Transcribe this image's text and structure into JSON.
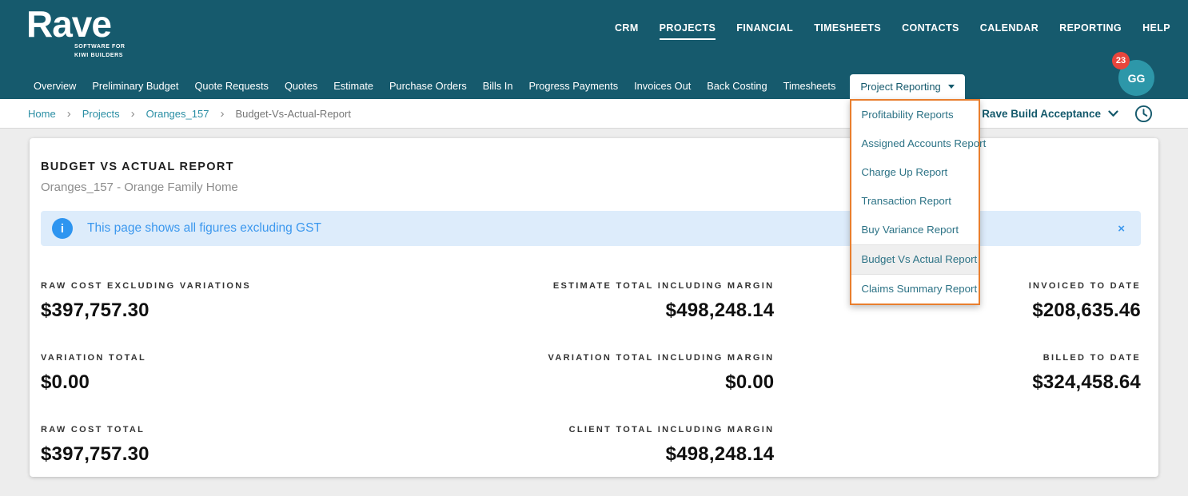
{
  "colors": {
    "header_teal": "#165a6d",
    "accent_orange": "#e87e2e",
    "badge_red": "#e8453c",
    "info_blue": "#3c98ee",
    "info_bg": "#ddecfb",
    "avatar_teal": "#2d97a9",
    "link_teal": "#2a8ea4"
  },
  "header": {
    "logo": {
      "word": "Rave",
      "tagline1": "SOFTWARE FOR",
      "tagline2": "KIWI BUILDERS"
    },
    "nav": [
      "CRM",
      "PROJECTS",
      "FINANCIAL",
      "TIMESHEETS",
      "CONTACTS",
      "CALENDAR",
      "REPORTING",
      "HELP"
    ],
    "active_nav": "PROJECTS",
    "avatar": {
      "initials": "GG",
      "badge_count": "23"
    }
  },
  "subnav": {
    "items": [
      "Overview",
      "Preliminary Budget",
      "Quote Requests",
      "Quotes",
      "Estimate",
      "Purchase Orders",
      "Bills In",
      "Progress Payments",
      "Invoices Out",
      "Back Costing",
      "Timesheets"
    ],
    "dropdown_label": "Project Reporting"
  },
  "dropdown_menu": {
    "items": [
      "Profitability Reports",
      "Assigned Accounts Report",
      "Charge Up Report",
      "Transaction Report",
      "Buy Variance Report",
      "Budget Vs Actual Report",
      "Claims Summary Report"
    ],
    "active_item": "Budget Vs Actual Report"
  },
  "breadcrumb": {
    "separator": "›",
    "links": [
      "Home",
      "Projects",
      "Oranges_157"
    ],
    "current": "Budget-Vs-Actual-Report"
  },
  "toolbar": {
    "project_selector": "Rave Build Acceptance"
  },
  "report": {
    "title": "BUDGET VS ACTUAL REPORT",
    "subtitle": "Oranges_157 - Orange Family Home",
    "banner": {
      "info_glyph": "i",
      "text": "This page shows all figures excluding GST",
      "close_glyph": "×"
    },
    "stats": [
      {
        "label": "RAW COST EXCLUDING VARIATIONS",
        "value": "$397,757.30"
      },
      {
        "label": "ESTIMATE TOTAL INCLUDING MARGIN",
        "value": "$498,248.14"
      },
      {
        "label": "INVOICED TO DATE",
        "value": "$208,635.46"
      },
      {
        "label": "VARIATION TOTAL",
        "value": "$0.00"
      },
      {
        "label": "VARIATION TOTAL INCLUDING MARGIN",
        "value": "$0.00"
      },
      {
        "label": "BILLED TO DATE",
        "value": "$324,458.64"
      },
      {
        "label": "RAW COST TOTAL",
        "value": "$397,757.30"
      },
      {
        "label": "CLIENT TOTAL INCLUDING MARGIN",
        "value": "$498,248.14"
      }
    ]
  }
}
